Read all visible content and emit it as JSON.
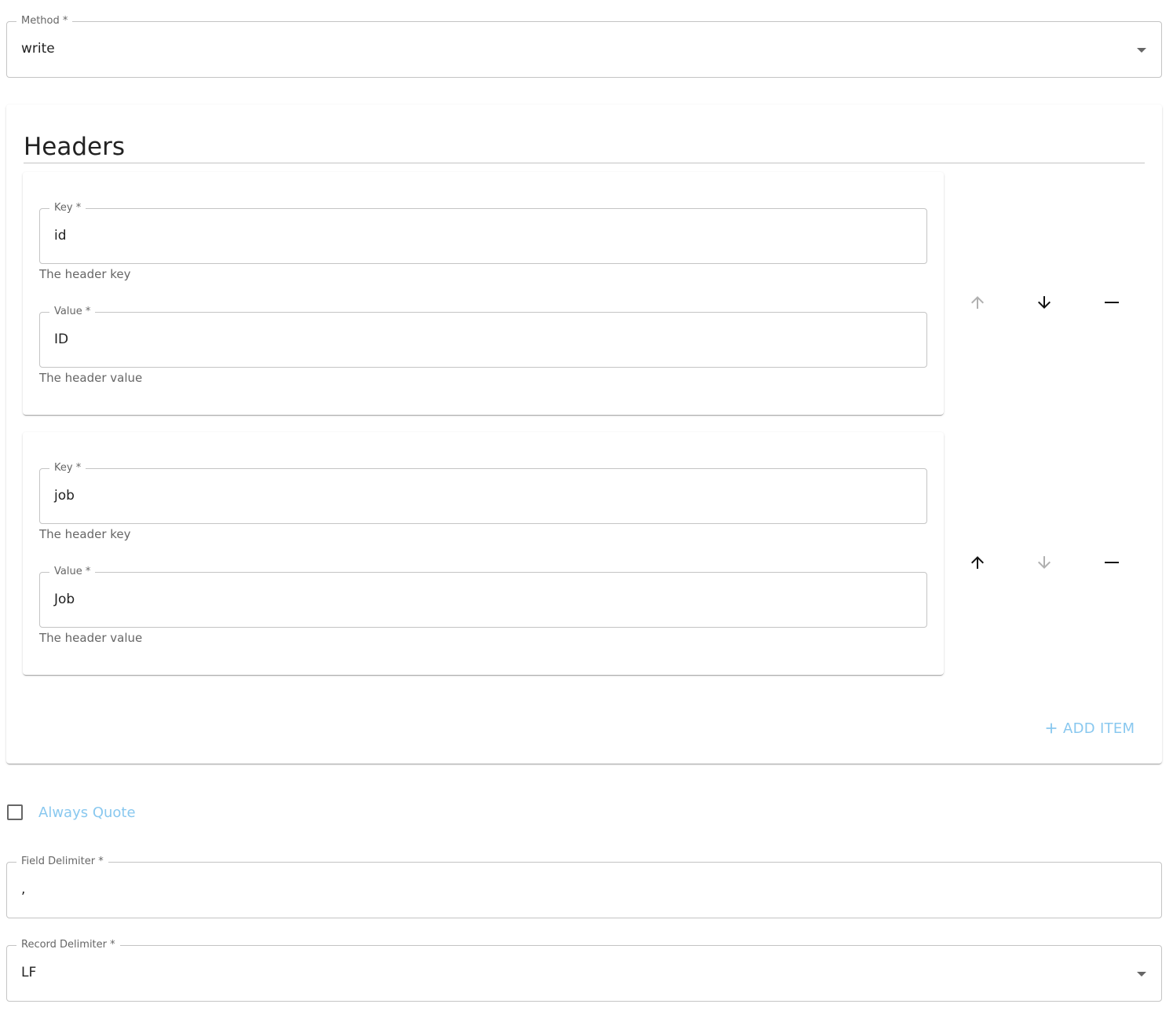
{
  "method": {
    "label": "Method *",
    "value": "write"
  },
  "headers": {
    "title": "Headers",
    "items": [
      {
        "key": {
          "label": "Key *",
          "value": "id",
          "helper": "The header key"
        },
        "value": {
          "label": "Value *",
          "value": "ID",
          "helper": "The header value"
        },
        "move_up_enabled": false,
        "move_down_enabled": true
      },
      {
        "key": {
          "label": "Key *",
          "value": "job",
          "helper": "The header key"
        },
        "value": {
          "label": "Value *",
          "value": "Job",
          "helper": "The header value"
        },
        "move_up_enabled": true,
        "move_down_enabled": false
      }
    ],
    "add_item_label": "ADD ITEM"
  },
  "always_quote": {
    "label": "Always Quote",
    "checked": false
  },
  "field_delimiter": {
    "label": "Field Delimiter *",
    "value": ","
  },
  "record_delimiter": {
    "label": "Record Delimiter *",
    "value": "LF"
  },
  "icons": {
    "move_up": "arrow-up-icon",
    "move_down": "arrow-down-icon",
    "remove": "minus-icon",
    "add": "plus-icon",
    "dropdown": "caret-down-icon"
  },
  "colors": {
    "accent_light": "#89c8ef",
    "disabled": "#b0b0b0",
    "text": "#222222",
    "helper": "#666666",
    "border": "#c4c4c4"
  }
}
